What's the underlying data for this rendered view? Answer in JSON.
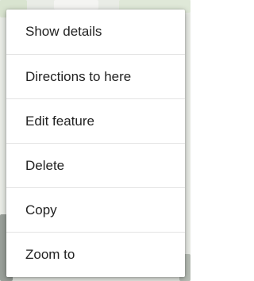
{
  "menu": {
    "items": [
      {
        "label": "Show details"
      },
      {
        "label": "Directions to here"
      },
      {
        "label": "Edit feature"
      },
      {
        "label": "Delete"
      },
      {
        "label": "Copy"
      },
      {
        "label": "Zoom to"
      }
    ]
  },
  "colors": {
    "menu_background": "#ffffff",
    "text": "#222222",
    "divider": "#e3e3e3",
    "map_background": "#e9ece6"
  }
}
